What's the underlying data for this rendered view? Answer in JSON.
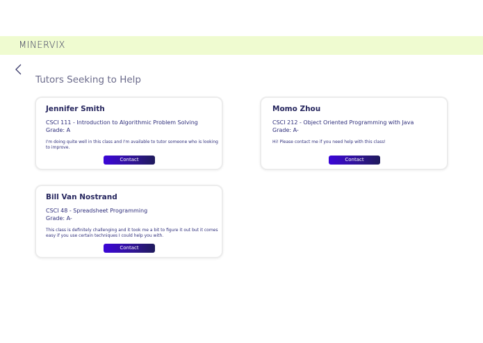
{
  "header": {
    "brand": "MINERVIX"
  },
  "nav": {
    "back_icon": "chevron-left-icon"
  },
  "page": {
    "title": "Tutors Seeking to Help"
  },
  "colors": {
    "header_bg": "#effbd0",
    "button": "#3b05d8",
    "text": "#2a2a6e"
  },
  "tutors": [
    {
      "name": "Jennifer Smith",
      "course": "CSCI 111 - Introduction to Algorithmic Problem Solving",
      "grade": "Grade: A",
      "message": "I'm doing quite well in this class and I'm available to tutor someone who is looking to improve.",
      "contact_label": "Contact"
    },
    {
      "name": "Momo Zhou",
      "course": "CSCI 212 - Object Oriented Programming with Java",
      "grade": "Grade: A-",
      "message": "Hi! Please contact me if you need help with this class!",
      "contact_label": "Contact"
    },
    {
      "name": "Bill Van Nostrand",
      "course": "CSCI 48 - Spreadsheet Programming",
      "grade": "Grade: A-",
      "message": "This class is definitely challenging and it took me a bit to figure it out but it comes easy if you use certain techniques I could help you with.",
      "contact_label": "Contact"
    }
  ]
}
